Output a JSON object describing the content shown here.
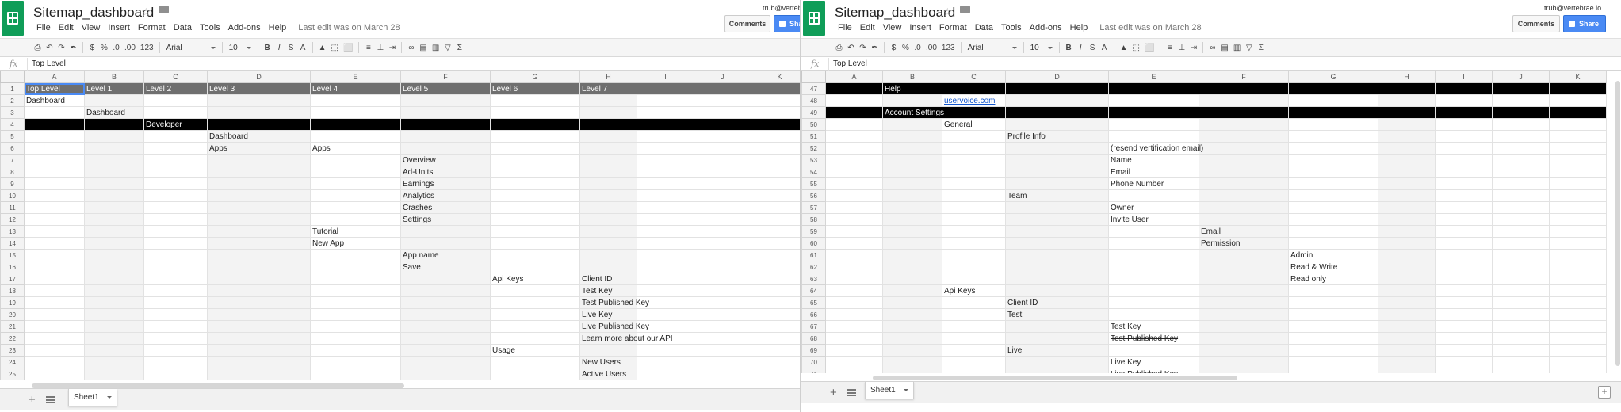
{
  "common": {
    "doc_title": "Sitemap_dashboard",
    "last_edit": "Last edit was on March 28",
    "menus": [
      "File",
      "Edit",
      "View",
      "Insert",
      "Format",
      "Data",
      "Tools",
      "Add-ons",
      "Help"
    ],
    "comments_label": "Comments",
    "share_label": "Share",
    "formula_value": "Top Level",
    "fx_label": "fx",
    "font_name": "Arial",
    "font_size": "10",
    "toolbar": {
      "print": "⎙",
      "undo": "↶",
      "redo": "↷",
      "paint_format": "✒",
      "currency": "$",
      "percent": "%",
      "dec_decrease": ".0",
      "dec_increase": ".00",
      "more_formats": "123",
      "bold": "B",
      "italic": "I",
      "strike": "S",
      "text_color": "A",
      "fill": "▲",
      "borders": "⬚",
      "merge": "⬜",
      "h_align": "≡",
      "v_align": "⊥",
      "wrap": "⇥",
      "link": "∞",
      "comment": "▤",
      "chart": "▥",
      "filter": "▽",
      "functions": "Σ"
    },
    "sheet_tab": "Sheet1",
    "columns": [
      "A",
      "B",
      "C",
      "D",
      "E",
      "F",
      "G",
      "H",
      "I",
      "J",
      "K"
    ],
    "colors": {
      "sheets_green": "#0f9d58",
      "share_blue": "#4a8af4",
      "header_gray": "#6f6f6f",
      "link_blue": "#1155cc"
    }
  },
  "left": {
    "account": "trub@vertebr...",
    "share_label": "Sha",
    "rows": [
      {
        "n": "1",
        "style": "gray",
        "cells": [
          "Top Level",
          "Level 1",
          "Level 2",
          "Level 3",
          "Level 4",
          "Level 5",
          "Level 6",
          "Level 7",
          "",
          "",
          ""
        ]
      },
      {
        "n": "2",
        "cells": [
          "Dashboard",
          "",
          "",
          "",
          "",
          "",
          "",
          "",
          "",
          "",
          ""
        ]
      },
      {
        "n": "3",
        "cells": [
          "",
          "Dashboard",
          "",
          "",
          "",
          "",
          "",
          "",
          "",
          "",
          ""
        ]
      },
      {
        "n": "4",
        "style": "black",
        "cells": [
          "",
          "",
          "Developer",
          "",
          "",
          "",
          "",
          "",
          "",
          "",
          ""
        ]
      },
      {
        "n": "5",
        "cells": [
          "",
          "",
          "",
          "Dashboard",
          "",
          "",
          "",
          "",
          "",
          "",
          ""
        ]
      },
      {
        "n": "6",
        "cells": [
          "",
          "",
          "",
          "Apps",
          "Apps",
          "",
          "",
          "",
          "",
          "",
          ""
        ]
      },
      {
        "n": "7",
        "cells": [
          "",
          "",
          "",
          "",
          "",
          "Overview",
          "",
          "",
          "",
          "",
          ""
        ]
      },
      {
        "n": "8",
        "cells": [
          "",
          "",
          "",
          "",
          "",
          "Ad-Units",
          "",
          "",
          "",
          "",
          ""
        ]
      },
      {
        "n": "9",
        "cells": [
          "",
          "",
          "",
          "",
          "",
          "Earnings",
          "",
          "",
          "",
          "",
          ""
        ]
      },
      {
        "n": "10",
        "cells": [
          "",
          "",
          "",
          "",
          "",
          "Analytics",
          "",
          "",
          "",
          "",
          ""
        ]
      },
      {
        "n": "11",
        "cells": [
          "",
          "",
          "",
          "",
          "",
          "Crashes",
          "",
          "",
          "",
          "",
          ""
        ]
      },
      {
        "n": "12",
        "cells": [
          "",
          "",
          "",
          "",
          "",
          "Settings",
          "",
          "",
          "",
          "",
          ""
        ]
      },
      {
        "n": "13",
        "cells": [
          "",
          "",
          "",
          "",
          "Tutorial",
          "",
          "",
          "",
          "",
          "",
          ""
        ]
      },
      {
        "n": "14",
        "bold": [
          4
        ],
        "cells": [
          "",
          "",
          "",
          "",
          "New App",
          "",
          "",
          "",
          "",
          "",
          ""
        ]
      },
      {
        "n": "15",
        "cells": [
          "",
          "",
          "",
          "",
          "",
          "App name",
          "",
          "",
          "",
          "",
          ""
        ]
      },
      {
        "n": "16",
        "cells": [
          "",
          "",
          "",
          "",
          "",
          "Save",
          "",
          "",
          "",
          "",
          ""
        ]
      },
      {
        "n": "17",
        "cells": [
          "",
          "",
          "",
          "",
          "",
          "",
          "Api Keys",
          "Client ID",
          "",
          "",
          ""
        ]
      },
      {
        "n": "18",
        "cells": [
          "",
          "",
          "",
          "",
          "",
          "",
          "",
          "Test Key",
          "",
          "",
          ""
        ]
      },
      {
        "n": "19",
        "cells": [
          "",
          "",
          "",
          "",
          "",
          "",
          "",
          "Test Published Key",
          "",
          "",
          ""
        ]
      },
      {
        "n": "20",
        "cells": [
          "",
          "",
          "",
          "",
          "",
          "",
          "",
          "Live Key",
          "",
          "",
          ""
        ]
      },
      {
        "n": "21",
        "cells": [
          "",
          "",
          "",
          "",
          "",
          "",
          "",
          "Live Published Key",
          "",
          "",
          ""
        ]
      },
      {
        "n": "22",
        "cells": [
          "",
          "",
          "",
          "",
          "",
          "",
          "",
          "Learn more about our API",
          "",
          "",
          ""
        ]
      },
      {
        "n": "23",
        "cells": [
          "",
          "",
          "",
          "",
          "",
          "",
          "Usage",
          "",
          "",
          "",
          ""
        ]
      },
      {
        "n": "24",
        "cells": [
          "",
          "",
          "",
          "",
          "",
          "",
          "",
          "New Users",
          "",
          "",
          ""
        ]
      },
      {
        "n": "25",
        "cells": [
          "",
          "",
          "",
          "",
          "",
          "",
          "",
          "Active Users",
          "",
          "",
          ""
        ]
      }
    ]
  },
  "right": {
    "account": "trub@vertebrae.io",
    "share_label": "Share",
    "rows": [
      {
        "n": "47",
        "style": "black",
        "cells": [
          "",
          "Help",
          "",
          "",
          "",
          "",
          "",
          "",
          "",
          "",
          ""
        ]
      },
      {
        "n": "48",
        "link": [
          2
        ],
        "cells": [
          "",
          "",
          "uservoice.com",
          "",
          "",
          "",
          "",
          "",
          "",
          "",
          ""
        ]
      },
      {
        "n": "49",
        "style": "black",
        "cells": [
          "",
          "Account Settings",
          "",
          "",
          "",
          "",
          "",
          "",
          "",
          "",
          ""
        ]
      },
      {
        "n": "50",
        "cells": [
          "",
          "",
          "General",
          "",
          "",
          "",
          "",
          "",
          "",
          "",
          ""
        ]
      },
      {
        "n": "51",
        "cells": [
          "",
          "",
          "",
          "Profile Info",
          "",
          "",
          "",
          "",
          "",
          "",
          ""
        ]
      },
      {
        "n": "52",
        "cells": [
          "",
          "",
          "",
          "",
          "(resend vertification email)",
          "",
          "",
          "",
          "",
          "",
          ""
        ]
      },
      {
        "n": "53",
        "cells": [
          "",
          "",
          "",
          "",
          "Name",
          "",
          "",
          "",
          "",
          "",
          ""
        ]
      },
      {
        "n": "54",
        "cells": [
          "",
          "",
          "",
          "",
          "Email",
          "",
          "",
          "",
          "",
          "",
          ""
        ]
      },
      {
        "n": "55",
        "cells": [
          "",
          "",
          "",
          "",
          "Phone Number",
          "",
          "",
          "",
          "",
          "",
          ""
        ]
      },
      {
        "n": "56",
        "cells": [
          "",
          "",
          "",
          "Team",
          "",
          "",
          "",
          "",
          "",
          "",
          ""
        ]
      },
      {
        "n": "57",
        "cells": [
          "",
          "",
          "",
          "",
          "Owner",
          "",
          "",
          "",
          "",
          "",
          ""
        ]
      },
      {
        "n": "58",
        "cells": [
          "",
          "",
          "",
          "",
          "Invite User",
          "",
          "",
          "",
          "",
          "",
          ""
        ]
      },
      {
        "n": "59",
        "cells": [
          "",
          "",
          "",
          "",
          "",
          "Email",
          "",
          "",
          "",
          "",
          ""
        ]
      },
      {
        "n": "60",
        "cells": [
          "",
          "",
          "",
          "",
          "",
          "Permission",
          "",
          "",
          "",
          "",
          ""
        ]
      },
      {
        "n": "61",
        "cells": [
          "",
          "",
          "",
          "",
          "",
          "",
          "Admin",
          "",
          "",
          "",
          ""
        ]
      },
      {
        "n": "62",
        "cells": [
          "",
          "",
          "",
          "",
          "",
          "",
          "Read & Write",
          "",
          "",
          "",
          ""
        ]
      },
      {
        "n": "63",
        "cells": [
          "",
          "",
          "",
          "",
          "",
          "",
          "Read only",
          "",
          "",
          "",
          ""
        ]
      },
      {
        "n": "64",
        "cells": [
          "",
          "",
          "Api Keys",
          "",
          "",
          "",
          "",
          "",
          "",
          "",
          ""
        ]
      },
      {
        "n": "65",
        "cells": [
          "",
          "",
          "",
          "Client ID",
          "",
          "",
          "",
          "",
          "",
          "",
          ""
        ]
      },
      {
        "n": "66",
        "cells": [
          "",
          "",
          "",
          "Test",
          "",
          "",
          "",
          "",
          "",
          "",
          ""
        ]
      },
      {
        "n": "67",
        "cells": [
          "",
          "",
          "",
          "",
          "Test Key",
          "",
          "",
          "",
          "",
          "",
          ""
        ]
      },
      {
        "n": "68",
        "strike": [
          4
        ],
        "cells": [
          "",
          "",
          "",
          "",
          "Test Published Key",
          "",
          "",
          "",
          "",
          "",
          ""
        ]
      },
      {
        "n": "69",
        "cells": [
          "",
          "",
          "",
          "Live",
          "",
          "",
          "",
          "",
          "",
          "",
          ""
        ]
      },
      {
        "n": "70",
        "cells": [
          "",
          "",
          "",
          "",
          "Live Key",
          "",
          "",
          "",
          "",
          "",
          ""
        ]
      },
      {
        "n": "71",
        "cells": [
          "",
          "",
          "",
          "",
          "Live Published Key",
          "",
          "",
          "",
          "",
          "",
          ""
        ]
      }
    ]
  }
}
